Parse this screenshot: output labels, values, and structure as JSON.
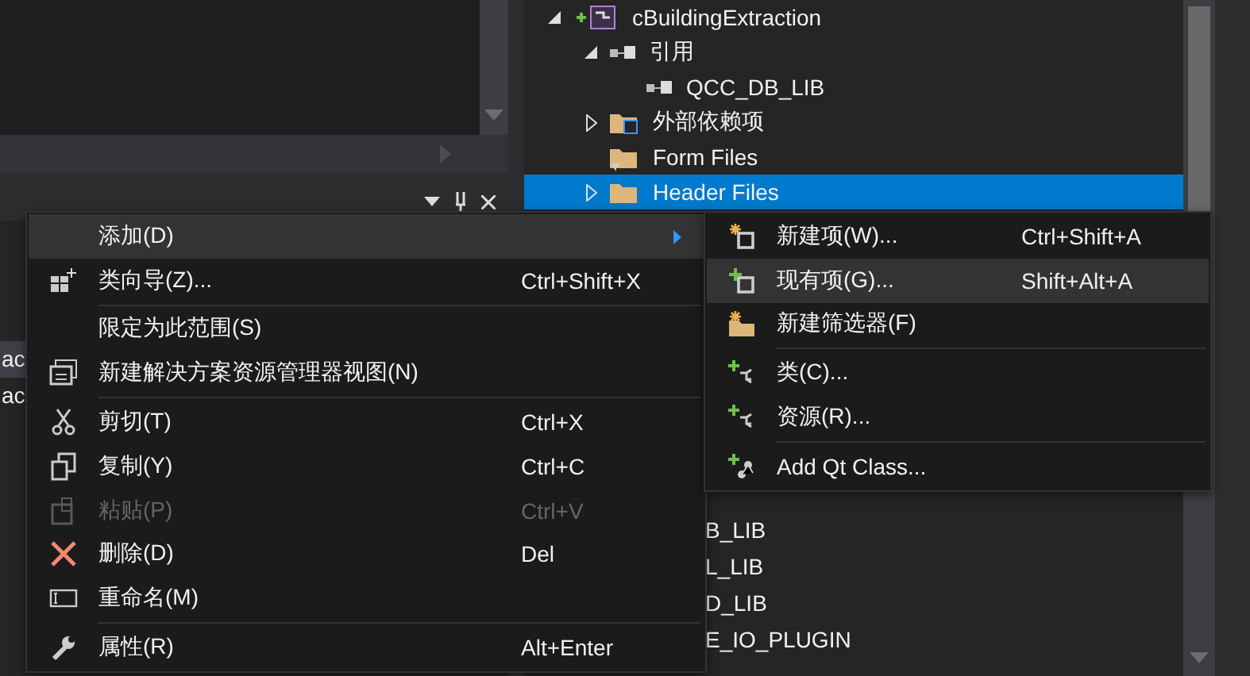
{
  "left_panel": {
    "rows": [
      {
        "label": "ac",
        "selected": true
      },
      {
        "label": "ac",
        "selected": false
      }
    ]
  },
  "solution_explorer": {
    "tree": [
      {
        "label": "cBuildingExtraction",
        "kind": "project",
        "expanded": true,
        "selected": false,
        "children": [
          {
            "label": "引用",
            "kind": "references",
            "expanded": true,
            "selected": false,
            "children": [
              {
                "label": "QCC_DB_LIB",
                "kind": "reference",
                "selected": false
              }
            ]
          },
          {
            "label": "外部依赖项",
            "kind": "external",
            "expanded": false,
            "selected": false
          },
          {
            "label": "Form Files",
            "kind": "filter",
            "selected": false
          },
          {
            "label": "Header Files",
            "kind": "folder",
            "expanded": false,
            "selected": true
          }
        ]
      }
    ],
    "partly_hidden_rows": [
      "B_LIB",
      "L_LIB",
      "D_LIB",
      "E_IO_PLUGIN"
    ]
  },
  "context_menu": {
    "items": [
      {
        "kind": "submenu",
        "label": "添加(D)",
        "selected": true,
        "disabled": false
      },
      {
        "kind": "class-wizard",
        "label": "类向导(Z)...",
        "shortcut": "Ctrl+Shift+X",
        "selected": false,
        "disabled": false
      },
      {
        "kind": "separator"
      },
      {
        "kind": "plain",
        "label": "限定为此范围(S)",
        "selected": false,
        "disabled": false
      },
      {
        "kind": "new-view",
        "label": "新建解决方案资源管理器视图(N)",
        "selected": false,
        "disabled": false
      },
      {
        "kind": "separator"
      },
      {
        "kind": "cut",
        "label": "剪切(T)",
        "shortcut": "Ctrl+X",
        "selected": false,
        "disabled": false
      },
      {
        "kind": "copy",
        "label": "复制(Y)",
        "shortcut": "Ctrl+C",
        "selected": false,
        "disabled": false
      },
      {
        "kind": "paste",
        "label": "粘贴(P)",
        "shortcut": "Ctrl+V",
        "selected": false,
        "disabled": true
      },
      {
        "kind": "delete",
        "label": "删除(D)",
        "shortcut": "Del",
        "selected": false,
        "disabled": false
      },
      {
        "kind": "rename",
        "label": "重命名(M)",
        "selected": false,
        "disabled": false
      },
      {
        "kind": "separator"
      },
      {
        "kind": "properties",
        "label": "属性(R)",
        "shortcut": "Alt+Enter",
        "selected": false,
        "disabled": false
      }
    ]
  },
  "submenu": {
    "items": [
      {
        "kind": "new-item",
        "label": "新建项(W)...",
        "shortcut": "Ctrl+Shift+A",
        "selected": false
      },
      {
        "kind": "existing-item",
        "label": "现有项(G)...",
        "shortcut": "Shift+Alt+A",
        "selected": true
      },
      {
        "kind": "new-filter",
        "label": "新建筛选器(F)",
        "selected": false
      },
      {
        "kind": "separator"
      },
      {
        "kind": "add-class",
        "label": "类(C)...",
        "selected": false
      },
      {
        "kind": "add-class",
        "label": "资源(R)...",
        "selected": false
      },
      {
        "kind": "separator"
      },
      {
        "kind": "add-qt-class",
        "label": "Add Qt Class...",
        "selected": false
      }
    ]
  }
}
